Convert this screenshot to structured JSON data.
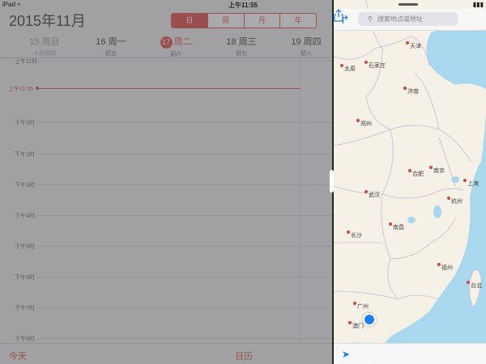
{
  "status_bar": {
    "device": "iPad",
    "time": "上午11:55"
  },
  "calendar": {
    "month_title": "2015年11月",
    "view_modes": [
      "日",
      "周",
      "月",
      "年"
    ],
    "days": [
      {
        "name": "15 周日",
        "lunar": "十月初四"
      },
      {
        "name": "16 周一",
        "lunar": "初五"
      },
      {
        "num": "17",
        "name": "周二",
        "lunar": "初六"
      },
      {
        "name": "18 周三",
        "lunar": "初七"
      },
      {
        "name": "19 周四",
        "lunar": "初八"
      }
    ],
    "hours": [
      "上午11时",
      "下午1时",
      "下午2时",
      "下午3时",
      "下午4时",
      "下午5时",
      "下午6时",
      "下午7时",
      "下午8时"
    ],
    "now_label": "上午11:55",
    "tab_today": "今天",
    "tab_calendars": "日历"
  },
  "map": {
    "search_placeholder": "搜索地点或地址",
    "cities": [
      {
        "name": "天津"
      },
      {
        "name": "太原"
      },
      {
        "name": "石家庄"
      },
      {
        "name": "济南"
      },
      {
        "name": "郑州"
      },
      {
        "name": "合肥"
      },
      {
        "name": "南京"
      },
      {
        "name": "上海"
      },
      {
        "name": "武汉"
      },
      {
        "name": "杭州"
      },
      {
        "name": "南昌"
      },
      {
        "name": "长沙"
      },
      {
        "name": "福州"
      },
      {
        "name": "台北"
      },
      {
        "name": "广州"
      },
      {
        "name": "澳门"
      }
    ]
  },
  "colors": {
    "accent_red": "#dd3333",
    "ios_blue": "#1e7cf5",
    "sea": "#a9d8ee",
    "land": "#f5f1e6"
  }
}
